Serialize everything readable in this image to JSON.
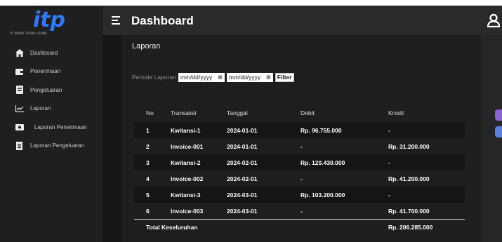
{
  "app": {
    "logo_text": "itp",
    "logo_subtitle": "PT INDRA TEKNO UTAMA",
    "colors": {
      "logo": "#2f79ff",
      "sidebar": "#1f1f1f",
      "header": "#2a2a2a",
      "main": "#1e1e1e"
    }
  },
  "sidebar": {
    "items": [
      {
        "label": "Dashboard",
        "icon": "home-icon"
      },
      {
        "label": "Penerimaan",
        "icon": "wallet-icon"
      },
      {
        "label": "Pengeluaran",
        "icon": "export-icon"
      },
      {
        "label": "Laporan",
        "icon": "chart-line-icon"
      },
      {
        "label": "Laporan Penerimaan",
        "icon": "money-icon"
      },
      {
        "label": "Laporan Pengeluaran",
        "icon": "document-icon"
      }
    ]
  },
  "header": {
    "title": "Dashboard"
  },
  "main": {
    "section_title": "Laporan",
    "filter": {
      "label": "Periode Laporan",
      "start_placeholder": "mm/dd/yyyy",
      "end_placeholder": "mm/dd/yyyy",
      "button_label": "Filter"
    },
    "table": {
      "headers": [
        "No",
        "Transaksi",
        "Tanggal",
        "Debit",
        "Kredit"
      ],
      "rows": [
        [
          "1",
          "Kwitansi-1",
          "2024-01-01",
          "Rp. 96.755.000",
          "-"
        ],
        [
          "2",
          "Invoice-001",
          "2024-01-01",
          "-",
          "Rp. 31.200.000"
        ],
        [
          "3",
          "Kwitansi-2",
          "2024-02-01",
          "Rp. 120.430.000",
          "-"
        ],
        [
          "4",
          "Invoice-002",
          "2024-02-01",
          "-",
          "Rp. 41.200.000"
        ],
        [
          "5",
          "Kwitansi-3",
          "2024-03-01",
          "Rp. 103.200.000",
          "-"
        ],
        [
          "6",
          "Invoice-003",
          "2024-03-01",
          "-",
          "Rp. 41.700.000"
        ]
      ],
      "total_label": "Total Keseluruhan",
      "total_value": "Rp. 206.285.000"
    }
  }
}
